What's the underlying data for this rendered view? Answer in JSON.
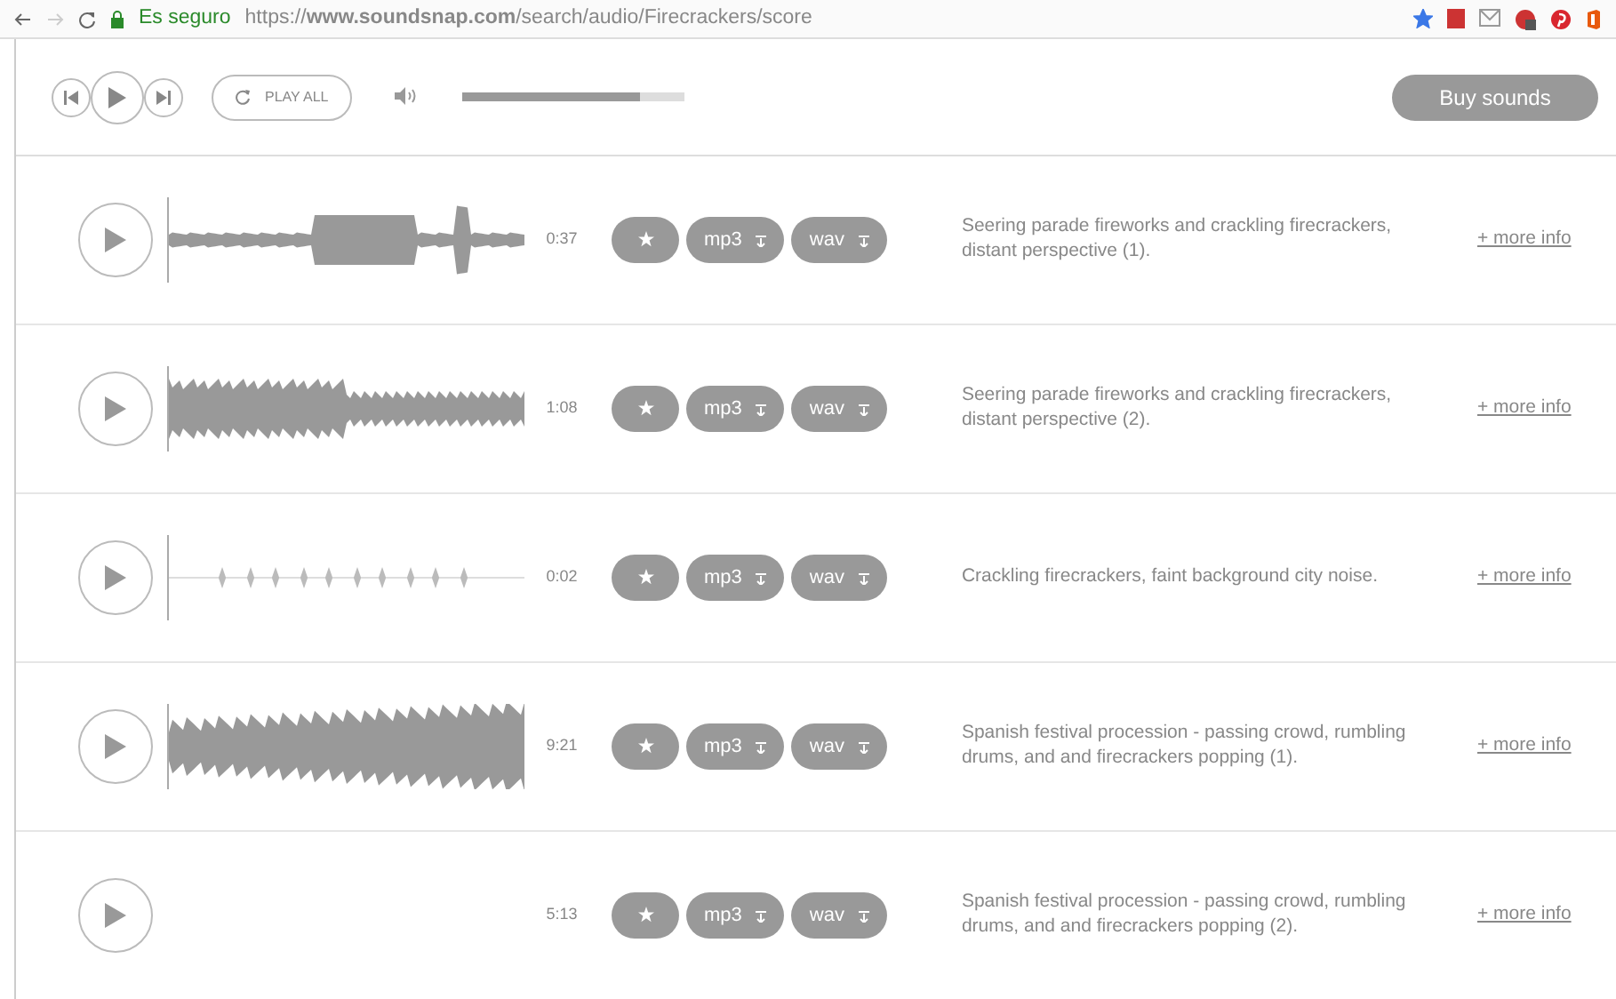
{
  "browser": {
    "security": "Es seguro",
    "url": "https://**www.soundsnap.com**/search/audio/Firecrackers/score",
    "forward_disabled": true,
    "bookmarked": true
  },
  "player": {
    "play_all": "PLAY ALL",
    "volume": {
      "level": 0.8
    },
    "buy": "Buy sounds"
  },
  "sounds": [
    {
      "waveform": true,
      "duration": "0:37",
      "formats": [
        "mp3",
        "wav"
      ],
      "description": "Seering parade fireworks and crackling firecrackers, distant perspective (1).",
      "more": "+ more info"
    },
    {
      "waveform": true,
      "duration": "1:08",
      "formats": [
        "mp3",
        "wav"
      ],
      "description": "Seering parade fireworks and crackling firecrackers, distant perspective (2).",
      "more": "+ more info"
    },
    {
      "waveform": true,
      "duration": "0:02",
      "formats": [
        "mp3",
        "wav"
      ],
      "description": "Crackling firecrackers, faint background city noise.",
      "more": "+ more info"
    },
    {
      "waveform": true,
      "duration": "9:21",
      "formats": [
        "mp3",
        "wav"
      ],
      "description": "Spanish festival procession - passing crowd, rumbling drums, and and firecrackers popping (1).",
      "more": "+ more info"
    },
    {
      "waveform": false,
      "duration": "5:13",
      "formats": [
        "mp3",
        "wav"
      ],
      "description": "Spanish festival procession - passing crowd, rumbling drums, and and firecrackers popping (2).",
      "more": "+ more info"
    }
  ]
}
